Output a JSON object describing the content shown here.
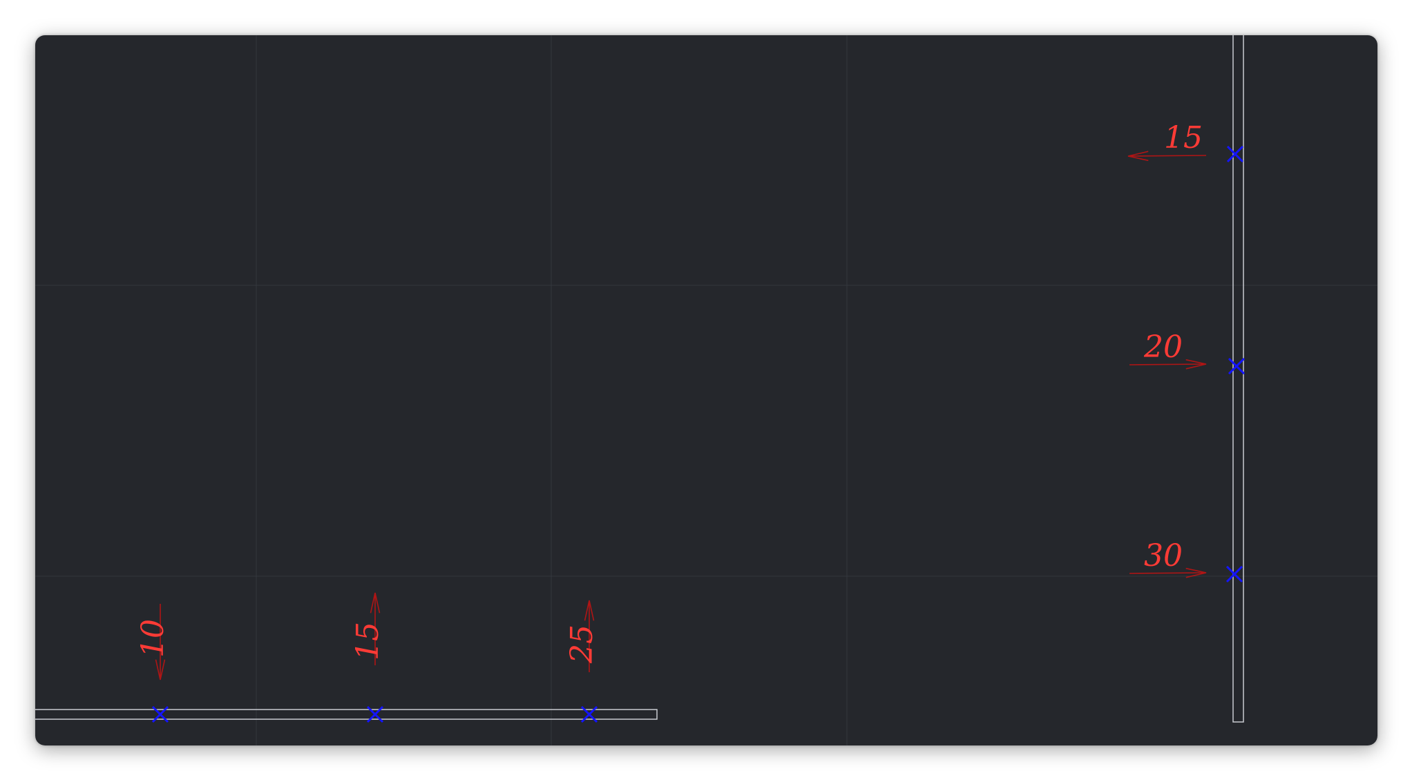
{
  "colors": {
    "background": "#25272c",
    "grid": "#34373d",
    "member": "#c9ccd1",
    "node_marker": "#1414ff",
    "load_arrow": "#b01515",
    "load_text": "#ff3b36"
  },
  "horizontal_member": {
    "loads": [
      {
        "label": "10",
        "direction": "down"
      },
      {
        "label": "15",
        "direction": "up"
      },
      {
        "label": "25",
        "direction": "up"
      }
    ]
  },
  "vertical_member": {
    "loads": [
      {
        "label": "15",
        "direction": "left"
      },
      {
        "label": "20",
        "direction": "right"
      },
      {
        "label": "30",
        "direction": "right"
      }
    ]
  }
}
